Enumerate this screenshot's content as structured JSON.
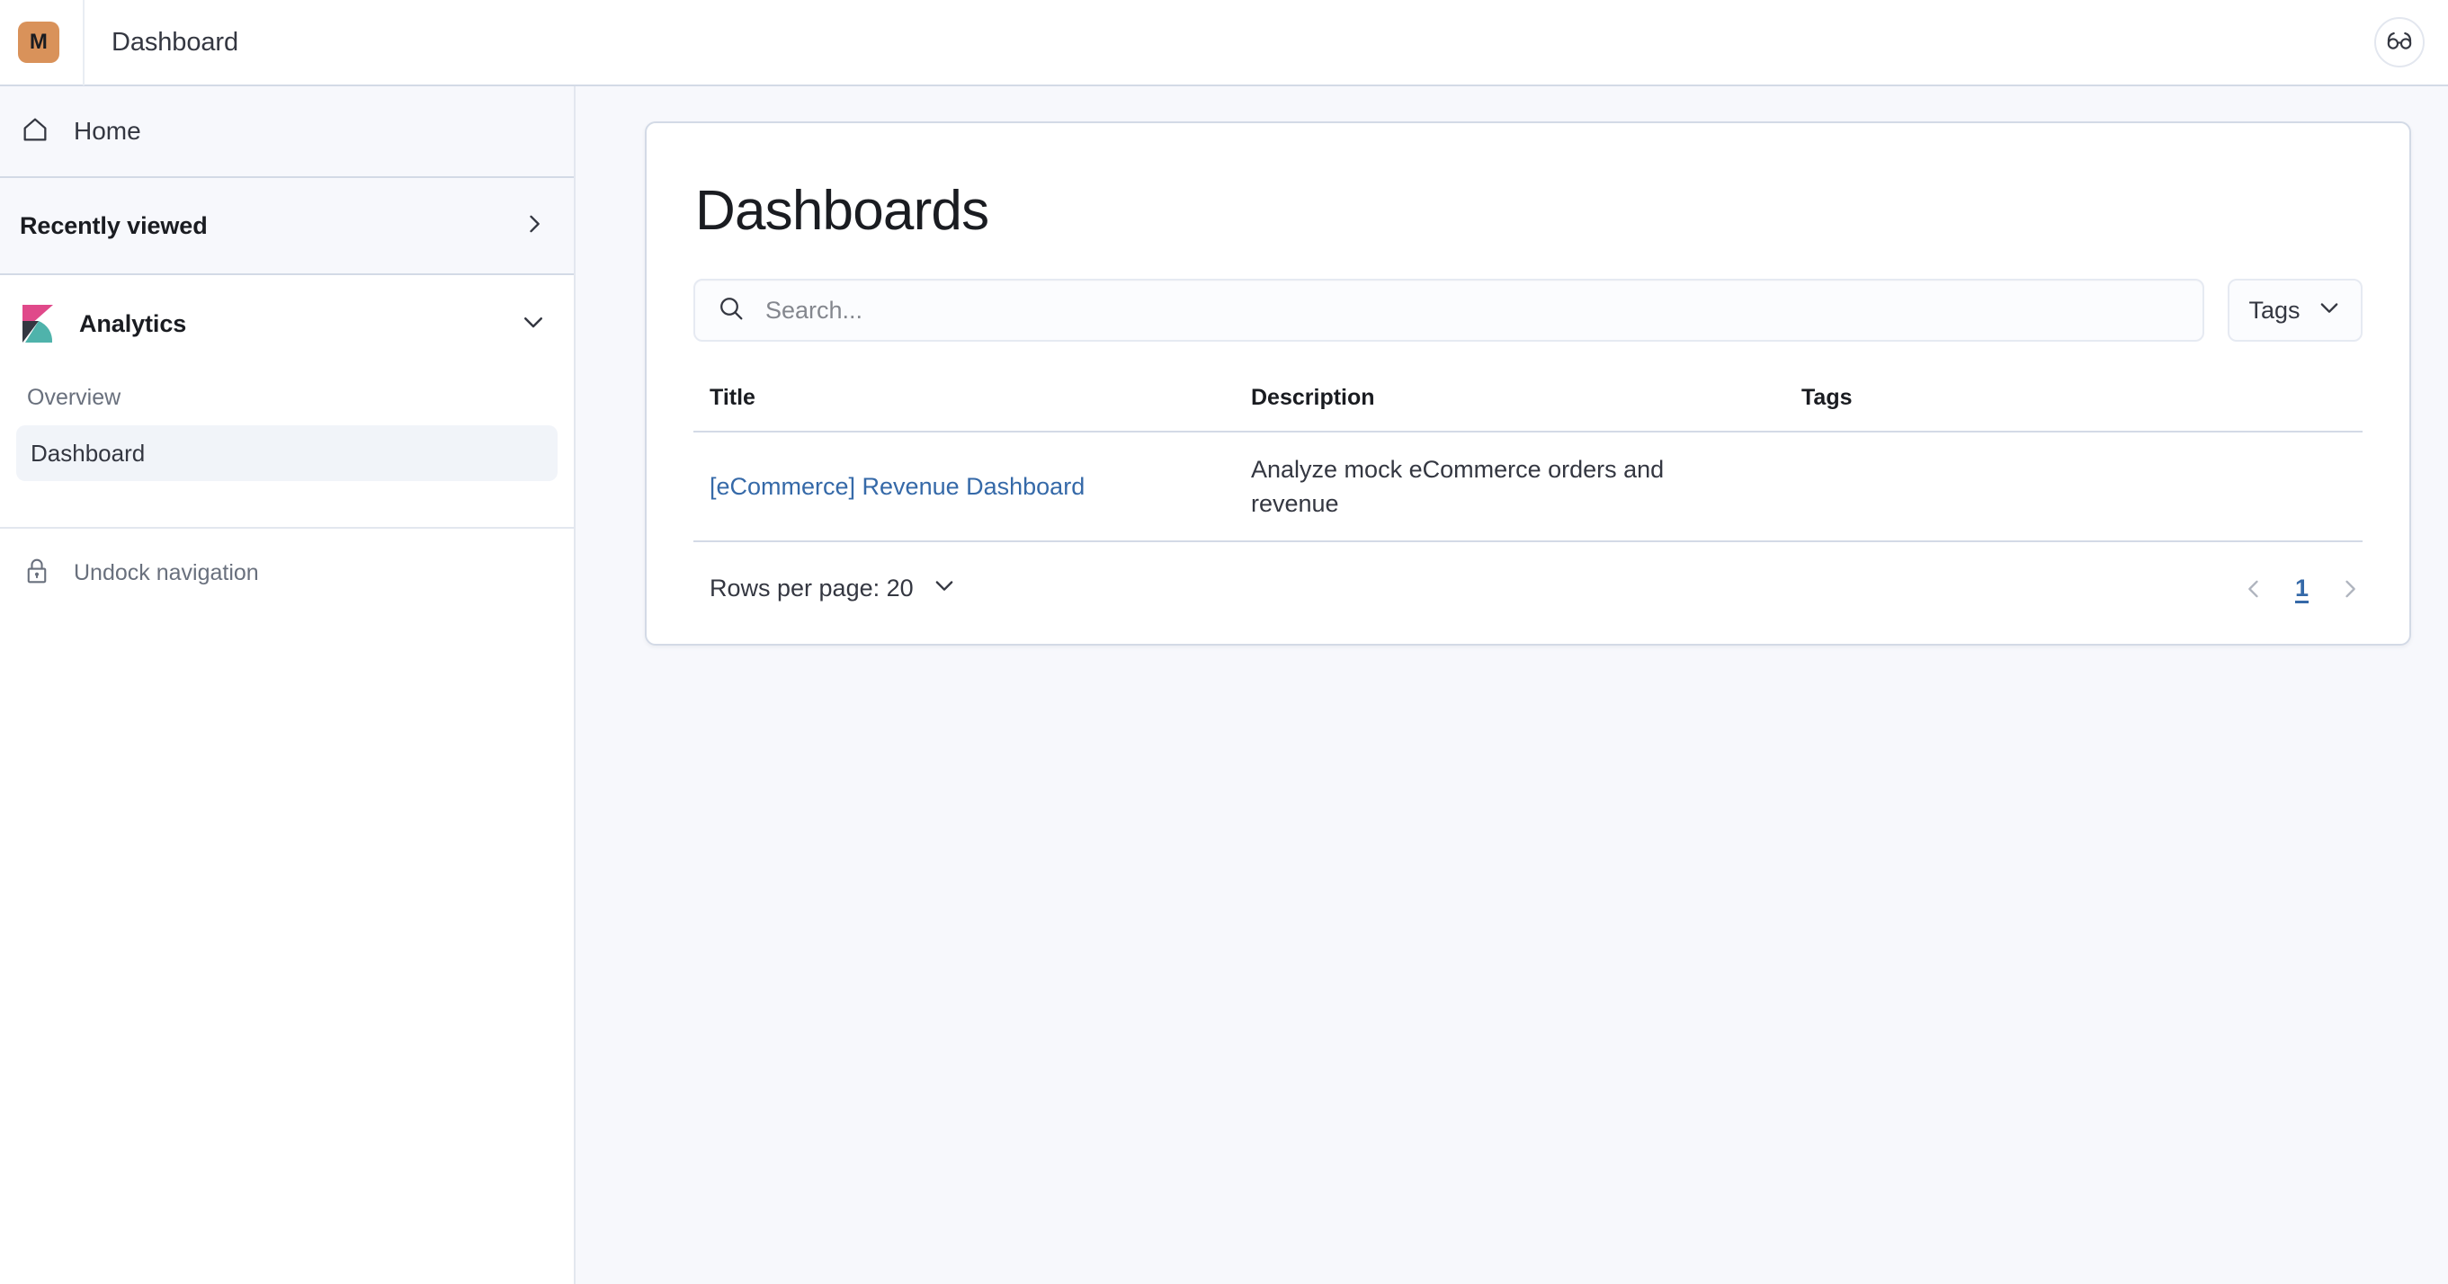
{
  "header": {
    "avatar_initial": "M",
    "breadcrumb_title": "Dashboard",
    "readonly_icon": "glasses-icon",
    "avatar_color": "#D9925A"
  },
  "sidebar": {
    "home": {
      "label": "Home",
      "icon": "home-icon"
    },
    "recently_viewed": {
      "label": "Recently viewed",
      "icon": "chevron-right-icon"
    },
    "solution": {
      "label": "Analytics",
      "icon": "kibana-logo",
      "chevron": "chevron-down-icon"
    },
    "group_title": "Overview",
    "items": [
      {
        "label": "Dashboard",
        "active": true
      }
    ],
    "footer": {
      "label": "Undock navigation",
      "icon": "lock-icon"
    }
  },
  "main": {
    "page_title": "Dashboards",
    "search": {
      "placeholder": "Search...",
      "value": "",
      "icon": "search-icon"
    },
    "tags_filter": {
      "label": "Tags",
      "icon": "chevron-down-icon"
    },
    "table": {
      "columns": [
        "Title",
        "Description",
        "Tags"
      ],
      "rows": [
        {
          "title": "[eCommerce] Revenue Dashboard",
          "description": "Analyze mock eCommerce orders and revenue",
          "tags": ""
        }
      ]
    },
    "footer": {
      "rows_per_page_label": "Rows per page: 20",
      "rows_per_page_icon": "chevron-down-icon",
      "prev_icon": "chevron-left-icon",
      "next_icon": "chevron-right-icon",
      "current_page": "1"
    }
  },
  "colors": {
    "link": "#3569A8",
    "page_bg": "#F7F8FC",
    "border": "#D3DAE6"
  }
}
